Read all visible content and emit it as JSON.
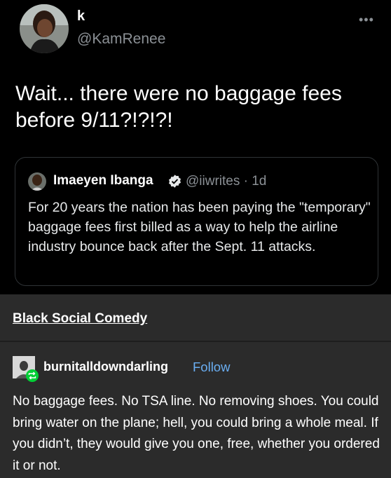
{
  "tweet": {
    "display_name": "k",
    "handle": "@KamRenee",
    "more_icon": "more-dots-icon",
    "text": "Wait... there were no baggage fees before 9/11?!?!?!"
  },
  "quote": {
    "author": "Imaeyen Ibanga",
    "verified_icon": "verified-badge-icon",
    "handle_time": "@iiwrites · 1d",
    "text": "For 20 years the nation has been paying the \"temporary\" baggage fees first billed as a way to help the airline industry bounce back after the Sept. 11 attacks."
  },
  "tumblr": {
    "blog_title": "Black Social Comedy",
    "reblogger": "burnitalldowndarling",
    "follow_label": "Follow",
    "reblog_icon": "reblog-icon",
    "text": "No baggage fees. No TSA line. No removing shoes. You could bring water on the plane; hell, you could bring a whole meal. If you didn’t, they would give you one, free, whether you ordered it or not."
  },
  "colors": {
    "tweet_bg": "#000000",
    "tumblr_bg": "#2b2b2b",
    "follow_link": "#6aaef2",
    "verified": "#1d9bf0",
    "reblog_badge": "#00cf35"
  }
}
